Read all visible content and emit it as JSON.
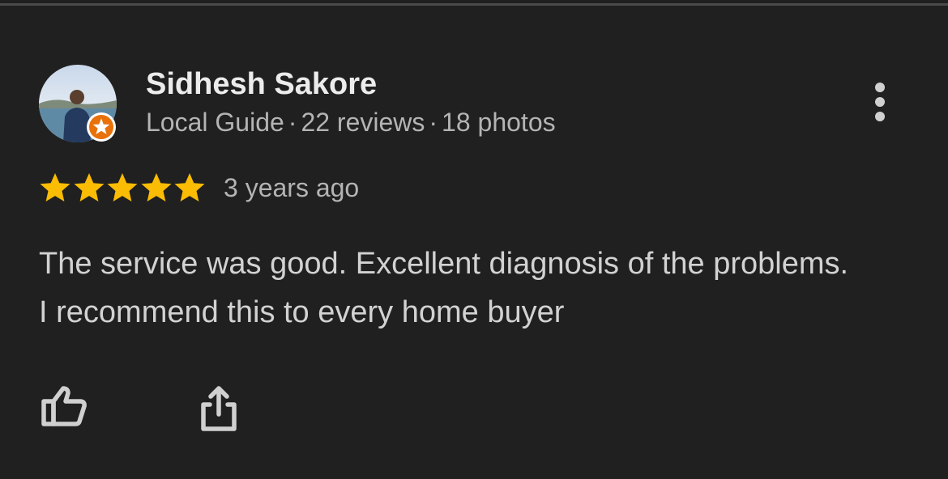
{
  "review": {
    "reviewer": {
      "name": "Sidhesh Sakore",
      "badge": "Local Guide",
      "reviews": "22 reviews",
      "photos": "18 photos",
      "separator": "·",
      "badge_icon": "star-badge-icon",
      "badge_color": "#e8710a"
    },
    "rating": 5,
    "rating_max": 5,
    "star_color": "#fbbc04",
    "time": "3 years ago",
    "text": "The service was good. Excellent diagnosis of the problems. I recommend this to every home buyer"
  },
  "actions": {
    "like_icon": "thumbs-up-icon",
    "share_icon": "share-icon",
    "more_icon": "more-vert-icon"
  }
}
